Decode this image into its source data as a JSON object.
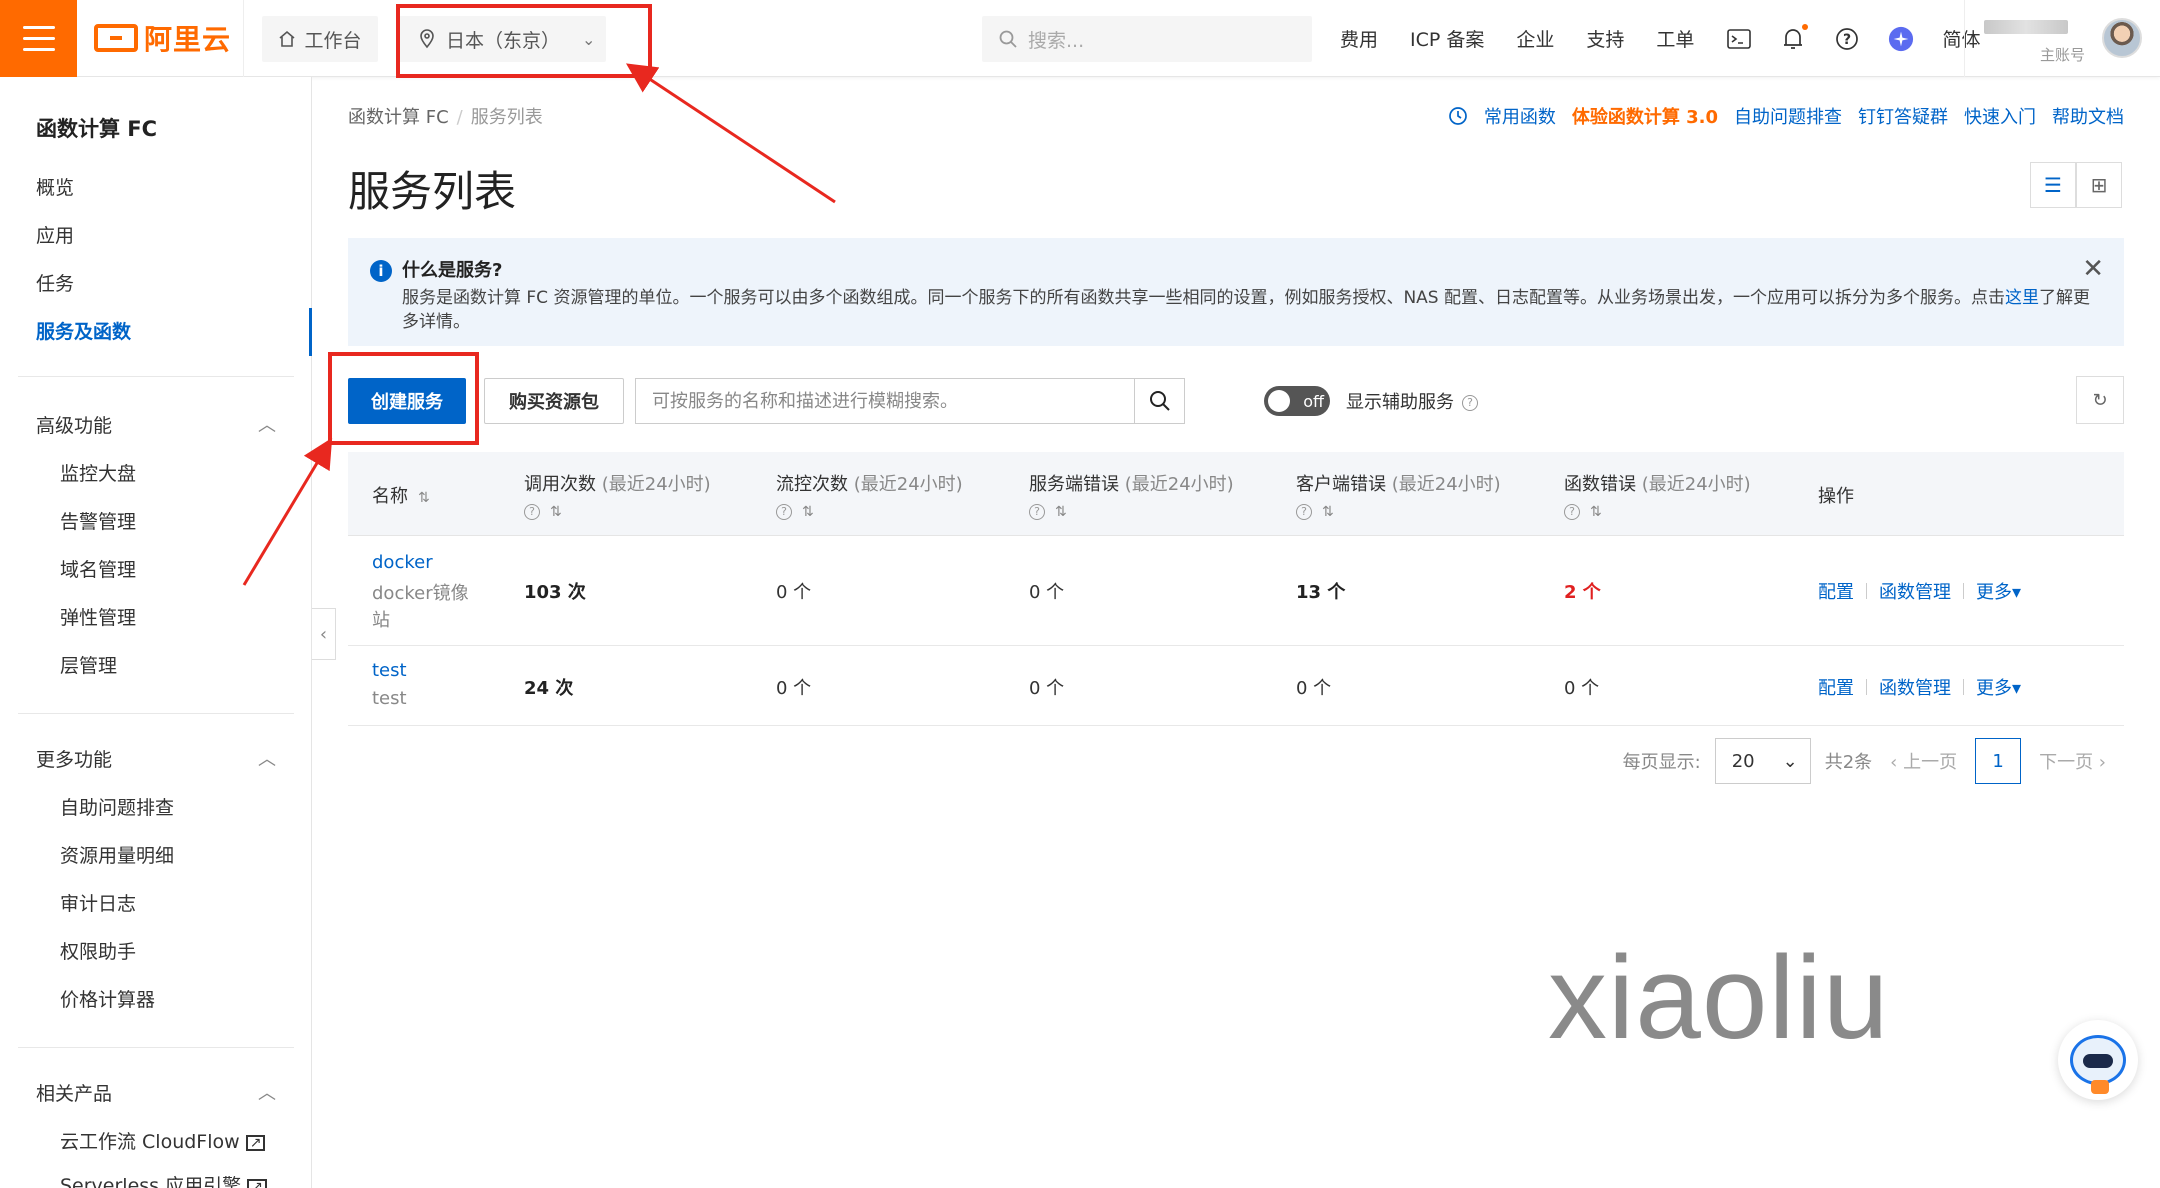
{
  "topbar": {
    "logo_text": "阿里云",
    "workbench": "工作台",
    "region": "日本（东京）",
    "search_placeholder": "搜索...",
    "nav": [
      "费用",
      "ICP 备案",
      "企业",
      "支持",
      "工单"
    ],
    "lang": "简体",
    "account_sub": "主账号"
  },
  "sidebar": {
    "title": "函数计算 FC",
    "items": [
      "概览",
      "应用",
      "任务",
      "服务及函数"
    ],
    "advanced": {
      "label": "高级功能",
      "items": [
        "监控大盘",
        "告警管理",
        "域名管理",
        "弹性管理",
        "层管理"
      ]
    },
    "more": {
      "label": "更多功能",
      "items": [
        "自助问题排查",
        "资源用量明细",
        "审计日志",
        "权限助手",
        "价格计算器"
      ]
    },
    "related": {
      "label": "相关产品",
      "items": [
        "云工作流 CloudFlow",
        "Serverless 应用引擎"
      ]
    }
  },
  "breadcrumb": {
    "root": "函数计算 FC",
    "current": "服务列表"
  },
  "quick_links": {
    "common": "常用函数",
    "try": "体验函数计算 3.0",
    "self_check": "自助问题排查",
    "dingtalk": "钉钉答疑群",
    "quickstart": "快速入门",
    "help": "帮助文档"
  },
  "page_title": "服务列表",
  "notice": {
    "title": "什么是服务?",
    "body": "服务是函数计算 FC 资源管理的单位。一个服务可以由多个函数组成。同一个服务下的所有函数共享一些相同的设置，例如服务授权、NAS 配置、日志配置等。从业务场景出发，一个应用可以拆分为多个服务。点击",
    "link": "这里",
    "tail": "了解更多详情。"
  },
  "toolbar": {
    "create": "创建服务",
    "buy": "购买资源包",
    "search_placeholder": "可按服务的名称和描述进行模糊搜索。",
    "toggle": "off",
    "toggle_label": "显示辅助服务"
  },
  "table": {
    "headers": {
      "name": "名称",
      "invocations": "调用次数",
      "throttles": "流控次数",
      "server_err": "服务端错误",
      "client_err": "客户端错误",
      "func_err": "函数错误",
      "window": "(最近24小时)",
      "ops": "操作"
    },
    "rows": [
      {
        "name": "docker",
        "desc": "docker镜像站",
        "invocations": "103 次",
        "throttles": "0 个",
        "server_err": "0 个",
        "client_err": "13 个",
        "func_err": "2 个"
      },
      {
        "name": "test",
        "desc": "test",
        "invocations": "24 次",
        "throttles": "0 个",
        "server_err": "0 个",
        "client_err": "0 个",
        "func_err": "0 个"
      }
    ],
    "ops": {
      "config": "配置",
      "manage": "函数管理",
      "more": "更多"
    }
  },
  "pager": {
    "per_page_label": "每页显示:",
    "per_page": "20",
    "total": "共2条",
    "prev": "上一页",
    "page": "1",
    "next": "下一页"
  },
  "watermark": "xiaoliu",
  "colors": {
    "brand": "#ff6a00",
    "primary": "#0064c8",
    "error": "#e02020",
    "annotation": "#e8281f"
  }
}
